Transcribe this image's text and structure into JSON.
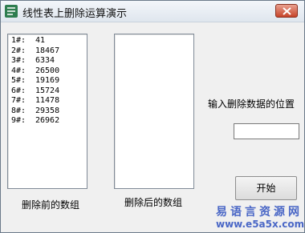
{
  "window": {
    "title": "线性表上删除运算演示"
  },
  "left_list": {
    "items": [
      {
        "index": "1#:",
        "value": "41"
      },
      {
        "index": "2#:",
        "value": "18467"
      },
      {
        "index": "3#:",
        "value": "6334"
      },
      {
        "index": "4#:",
        "value": "26500"
      },
      {
        "index": "5#:",
        "value": "19169"
      },
      {
        "index": "6#:",
        "value": "15724"
      },
      {
        "index": "7#:",
        "value": "11478"
      },
      {
        "index": "8#:",
        "value": "29358"
      },
      {
        "index": "9#:",
        "value": "26962"
      }
    ],
    "caption": "删除前的数组"
  },
  "right_list": {
    "items": [],
    "caption": "删除后的数组"
  },
  "position_input": {
    "prompt": "输入删除数据的位置",
    "value": ""
  },
  "start_button": {
    "label": "开始"
  },
  "watermark": {
    "line1": "易语言资源网",
    "line2": "www.e5a5x.com"
  },
  "colors": {
    "close_button": "#c6442a",
    "watermark": "#4a67c6",
    "app_icon": "#2e7d4f"
  }
}
